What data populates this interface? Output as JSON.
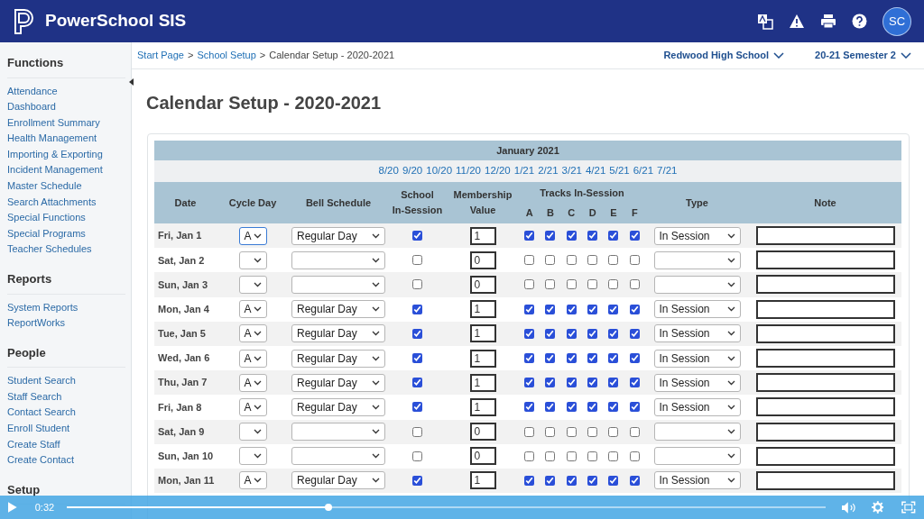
{
  "app": {
    "title": "PowerSchool SIS",
    "user_initials": "SC"
  },
  "sidebar": {
    "sections": [
      {
        "heading": "Functions",
        "items": [
          "Attendance",
          "Dashboard",
          "Enrollment Summary",
          "Health Management",
          "Importing & Exporting",
          "Incident Management",
          "Master Schedule",
          "Search Attachments",
          "Special Functions",
          "Special Programs",
          "Teacher Schedules"
        ]
      },
      {
        "heading": "Reports",
        "items": [
          "System Reports",
          "ReportWorks"
        ]
      },
      {
        "heading": "People",
        "items": [
          "Student Search",
          "Staff Search",
          "Contact Search",
          "Enroll Student",
          "Create Staff",
          "Create Contact"
        ]
      },
      {
        "heading": "Setup"
      }
    ]
  },
  "breadcrumb": {
    "separator": ">",
    "links": [
      "Start Page",
      "School Setup"
    ],
    "current": "Calendar Setup - 2020-2021"
  },
  "school_selector": "Redwood High School",
  "term_selector": "20-21 Semester 2",
  "page_title": "Calendar Setup - 2020-2021",
  "calendar": {
    "month": "January 2021",
    "month_links": [
      "8/20",
      "9/20",
      "10/20",
      "11/20",
      "12/20",
      "1/21",
      "2/21",
      "3/21",
      "4/21",
      "5/21",
      "6/21",
      "7/21"
    ],
    "columns": {
      "date": "Date",
      "cycle_day": "Cycle Day",
      "bell_schedule": "Bell Schedule",
      "school_in_session": [
        "School",
        "In-Session"
      ],
      "membership_value": [
        "Membership",
        "Value"
      ],
      "tracks": "Tracks In-Session",
      "type": "Type",
      "note": "Note"
    },
    "track_labels": [
      "A",
      "B",
      "C",
      "D",
      "E",
      "F"
    ],
    "rows": [
      {
        "date": "Fri, Jan 1",
        "cycle_day": "A",
        "bell_schedule": "Regular Day",
        "in_session": true,
        "membership": "1",
        "tracks": [
          true,
          true,
          true,
          true,
          true,
          true
        ],
        "type": "In Session"
      },
      {
        "date": "Sat, Jan 2",
        "in_session": false,
        "membership": "0",
        "tracks": [
          false,
          false,
          false,
          false,
          false,
          false
        ]
      },
      {
        "date": "Sun, Jan 3",
        "in_session": false,
        "membership": "0",
        "tracks": [
          false,
          false,
          false,
          false,
          false,
          false
        ]
      },
      {
        "date": "Mon, Jan 4",
        "cycle_day": "A",
        "bell_schedule": "Regular Day",
        "in_session": true,
        "membership": "1",
        "tracks": [
          true,
          true,
          true,
          true,
          true,
          true
        ],
        "type": "In Session"
      },
      {
        "date": "Tue, Jan 5",
        "cycle_day": "A",
        "bell_schedule": "Regular Day",
        "in_session": true,
        "membership": "1",
        "tracks": [
          true,
          true,
          true,
          true,
          true,
          true
        ],
        "type": "In Session"
      },
      {
        "date": "Wed, Jan 6",
        "cycle_day": "A",
        "bell_schedule": "Regular Day",
        "in_session": true,
        "membership": "1",
        "tracks": [
          true,
          true,
          true,
          true,
          true,
          true
        ],
        "type": "In Session"
      },
      {
        "date": "Thu, Jan 7",
        "cycle_day": "A",
        "bell_schedule": "Regular Day",
        "in_session": true,
        "membership": "1",
        "tracks": [
          true,
          true,
          true,
          true,
          true,
          true
        ],
        "type": "In Session"
      },
      {
        "date": "Fri, Jan 8",
        "cycle_day": "A",
        "bell_schedule": "Regular Day",
        "in_session": true,
        "membership": "1",
        "tracks": [
          true,
          true,
          true,
          true,
          true,
          true
        ],
        "type": "In Session"
      },
      {
        "date": "Sat, Jan 9",
        "in_session": false,
        "membership": "0",
        "tracks": [
          false,
          false,
          false,
          false,
          false,
          false
        ]
      },
      {
        "date": "Sun, Jan 10",
        "in_session": false,
        "membership": "0",
        "tracks": [
          false,
          false,
          false,
          false,
          false,
          false
        ]
      },
      {
        "date": "Mon, Jan 11",
        "cycle_day": "A",
        "bell_schedule": "Regular Day",
        "in_session": true,
        "membership": "1",
        "tracks": [
          true,
          true,
          true,
          true,
          true,
          true
        ],
        "type": "In Session"
      }
    ]
  },
  "video_player": {
    "time": "0:32",
    "level": 0.345
  }
}
